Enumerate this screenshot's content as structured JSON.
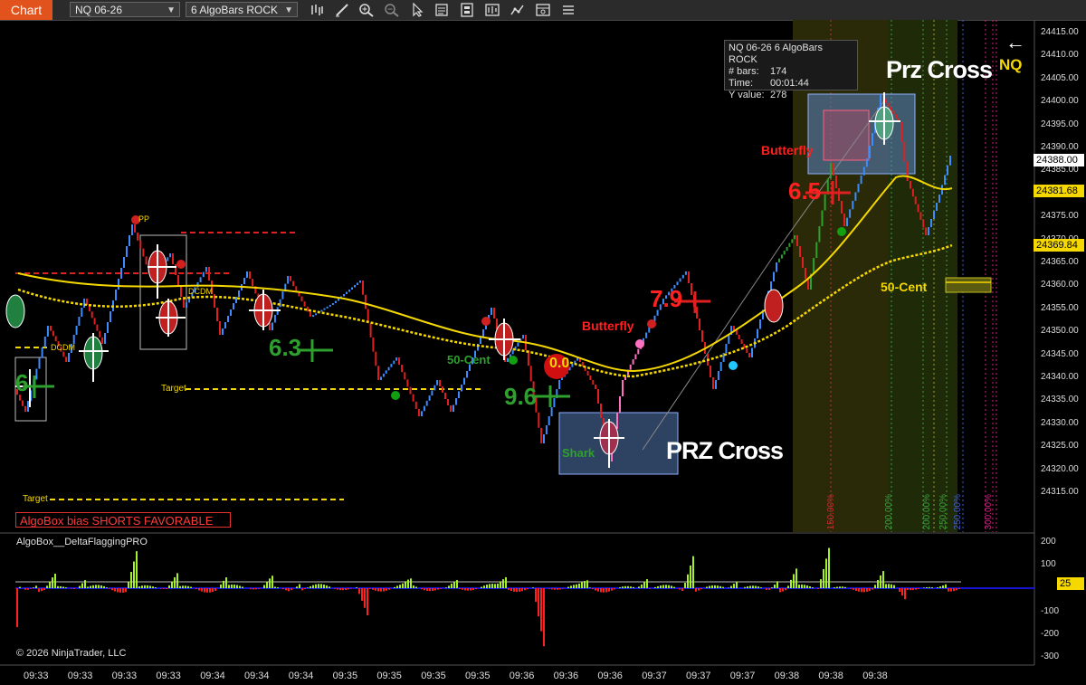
{
  "toolbar": {
    "chart_tab": "Chart",
    "instrument_select": "NQ 06-26",
    "bartype_select": "6 AlgoBars ROCK",
    "icons": [
      "bar-style-icon",
      "draw-tool-icon",
      "zoom-in-icon",
      "zoom-out-icon",
      "cursor-icon",
      "data-box-icon",
      "chart-trader-icon",
      "templates-icon",
      "strategy-icon",
      "properties-icon",
      "indicators-icon"
    ]
  },
  "info_box": {
    "title": "NQ 06-26 6 AlgoBars ROCK",
    "rows": [
      {
        "label": "# bars:",
        "value": "174"
      },
      {
        "label": "Time:",
        "value": "00:01:44"
      },
      {
        "label": "Y value:",
        "value": "278"
      }
    ]
  },
  "price_axis": {
    "ticks": [
      "24415.00",
      "24410.00",
      "24405.00",
      "24400.00",
      "24395.00",
      "24390.00",
      "24385.00",
      "24380.00",
      "24375.00",
      "24370.00",
      "24365.00",
      "24360.00",
      "24355.00",
      "24350.00",
      "24345.00",
      "24340.00",
      "24335.00",
      "24330.00",
      "24325.00",
      "24320.00",
      "24315.00"
    ],
    "labels": [
      {
        "text": "24388.00",
        "color": "#000000",
        "bg": "#ffffff"
      },
      {
        "text": "24381.68",
        "color": "#000000",
        "bg": "#f5d800"
      },
      {
        "text": "24369.84",
        "color": "#000000",
        "bg": "#f5d800"
      }
    ]
  },
  "indicator_axis": {
    "ticks": [
      "200",
      "100",
      "-100",
      "-200",
      "-300"
    ],
    "level_label": "25"
  },
  "time_axis": [
    "09:33",
    "09:33",
    "09:33",
    "09:33",
    "09:34",
    "09:34",
    "09:34",
    "09:35",
    "09:35",
    "09:35",
    "09:35",
    "09:36",
    "09:36",
    "09:36",
    "09:37",
    "09:37",
    "09:37",
    "09:38",
    "09:38",
    "09:38"
  ],
  "annotations": {
    "prz_cross_top": "Prz Cross",
    "prz_cross_bottom": "PRZ Cross",
    "nq_label": "NQ",
    "back_arrow": "←",
    "butterfly_1": "Butterfly",
    "butterfly_2": "Butterfly",
    "shark": "Shark",
    "fifty_cent_1": "50-Cent",
    "fifty_cent_2": "50-Cent",
    "signal_65": "6.5",
    "signal_79": "7.9",
    "signal_63": "6.3",
    "signal_96": "9.6",
    "signal_6": "6",
    "signal_00": "0.0",
    "dcdm_1": "DCDM",
    "dcdm_2": "DCDM",
    "target_1": "Target",
    "target_2": "Target",
    "pp": "PP",
    "percent_200_1": "200.00%",
    "percent_200_2": "200.00%",
    "percent_250": "250.00%",
    "percent_300": "300.00%",
    "percent_150": "150.00%"
  },
  "bias_box": "AlgoBox bias SHORTS FAVORABLE",
  "indicator_title": "AlgoBox__DeltaFlaggingPRO",
  "copyright": "© 2026 NinjaTrader, LLC",
  "colors": {
    "accent": "#e2521d",
    "up_bar": "#3b8cff",
    "down_bar": "#e02020",
    "ma": "#f5d800",
    "delta_pos": "#a6f02a",
    "delta_neg": "#ff2020",
    "zero_line": "#1414d0"
  }
}
